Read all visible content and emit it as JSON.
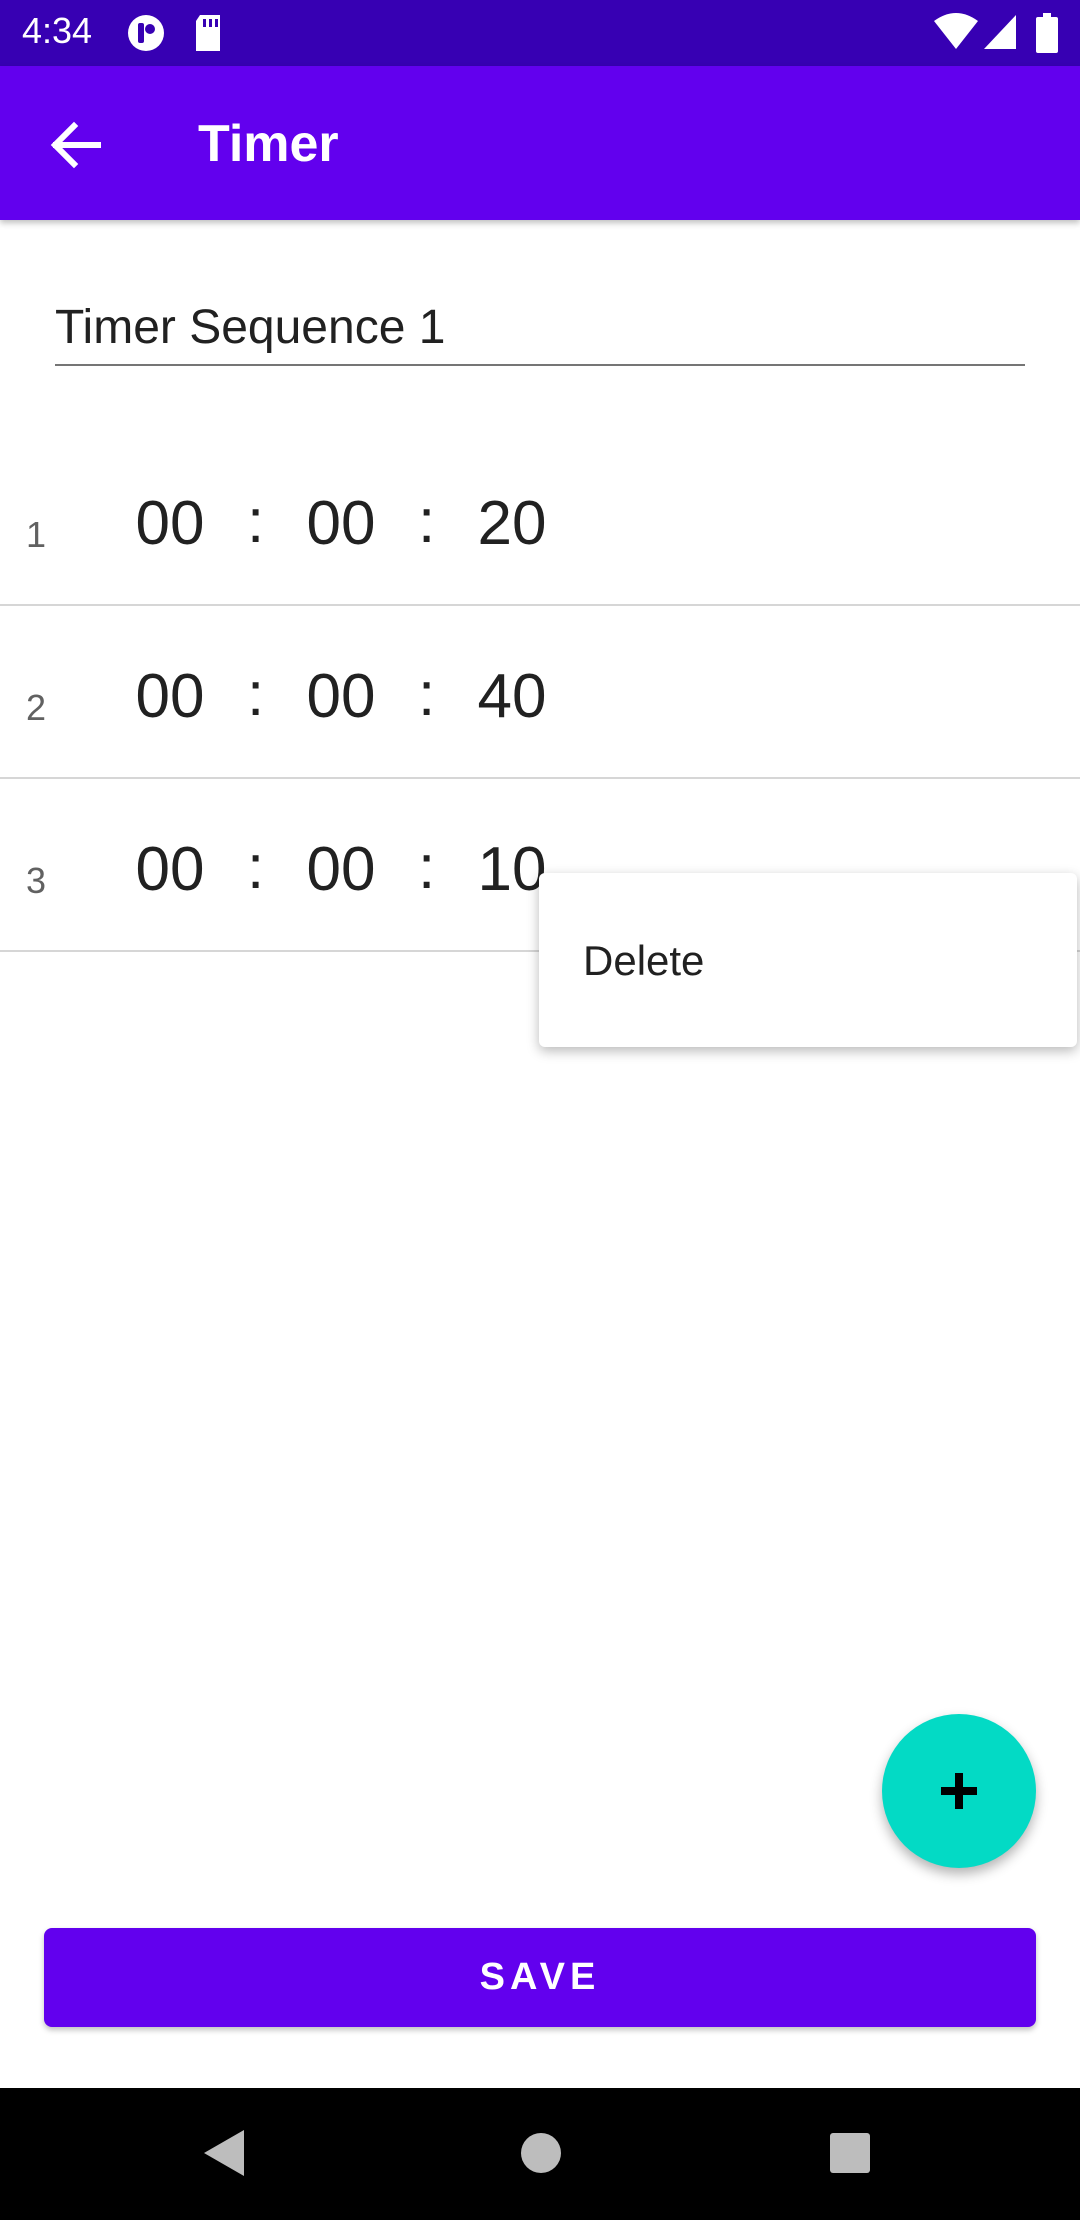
{
  "status_bar": {
    "time": "4:34",
    "icons": [
      "pocket-icon",
      "sd-card-icon",
      "wifi-icon",
      "signal-icon",
      "battery-icon"
    ]
  },
  "app_bar": {
    "back_icon": "arrow-back-icon",
    "title": "Timer",
    "color": "#6200ee"
  },
  "sequence": {
    "name": "Timer Sequence 1"
  },
  "timers": [
    {
      "index": "1",
      "hours": "00",
      "minutes": "00",
      "seconds": "20"
    },
    {
      "index": "2",
      "hours": "00",
      "minutes": "00",
      "seconds": "40"
    },
    {
      "index": "3",
      "hours": "00",
      "minutes": "00",
      "seconds": "10"
    }
  ],
  "separator": ":",
  "popup_menu": {
    "items": [
      "Delete"
    ]
  },
  "fab": {
    "icon": "add-icon",
    "color": "#03dac5"
  },
  "save_button": {
    "label": "SAVE"
  },
  "nav_bar": {
    "icons": [
      "back-triangle-icon",
      "home-circle-icon",
      "recents-square-icon"
    ]
  }
}
